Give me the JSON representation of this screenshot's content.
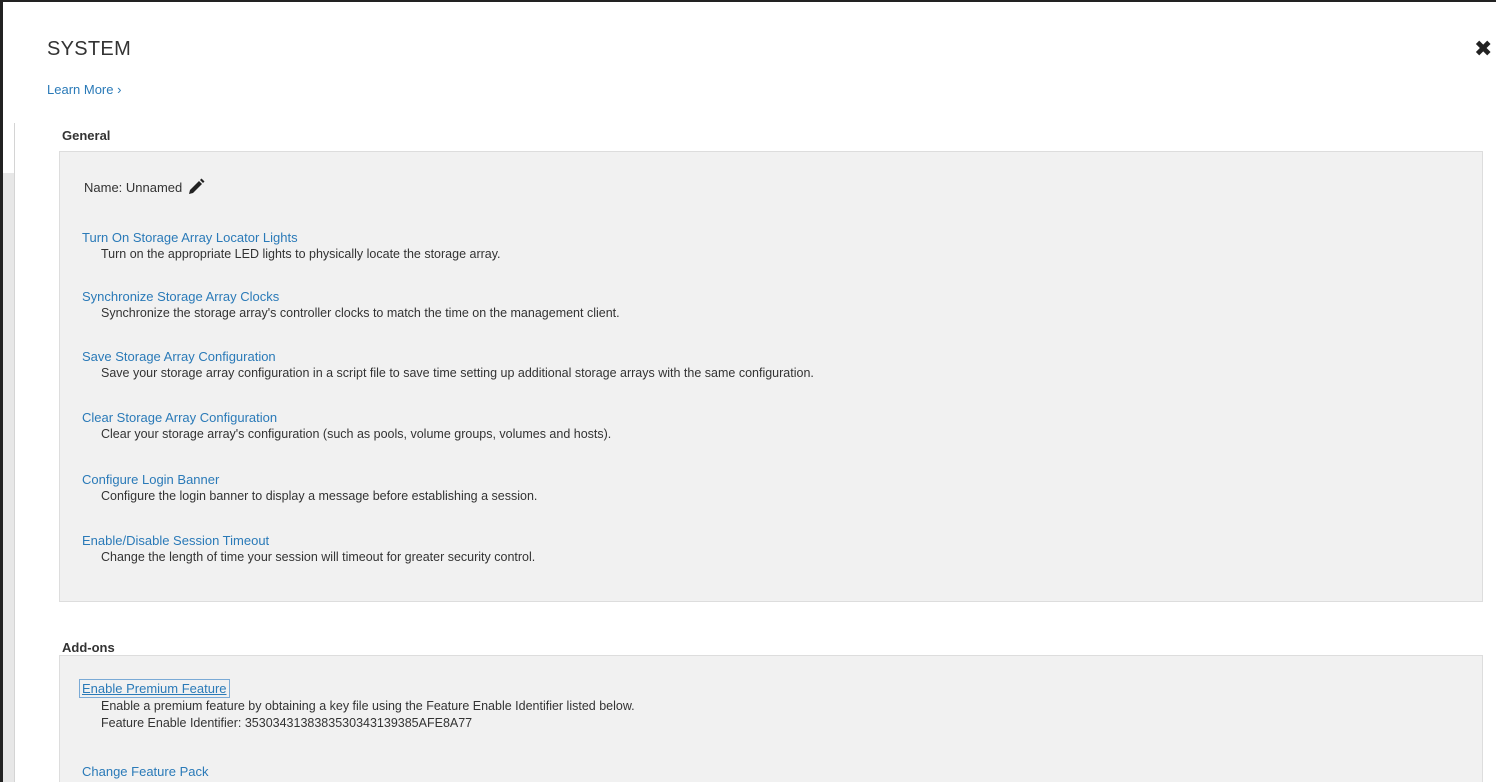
{
  "dialog": {
    "title": "SYSTEM",
    "close_label": "✖",
    "learn_more": "Learn More ›"
  },
  "general": {
    "heading": "General",
    "name_label": "Name: Unnamed",
    "items": [
      {
        "link": "Turn On Storage Array Locator Lights",
        "desc": "Turn on the appropriate LED lights to physically locate the storage array."
      },
      {
        "link": "Synchronize Storage Array Clocks",
        "desc": "Synchronize the storage array's controller clocks to match the time on the management client."
      },
      {
        "link": "Save Storage Array Configuration",
        "desc": "Save your storage array configuration in a script file to save time setting up additional storage arrays with the same configuration."
      },
      {
        "link": "Clear Storage Array Configuration",
        "desc": "Clear your storage array's configuration (such as pools, volume groups, volumes and hosts)."
      },
      {
        "link": "Configure Login Banner",
        "desc": "Configure the login banner to display a message before establishing a session."
      },
      {
        "link": "Enable/Disable Session Timeout",
        "desc": "Change the length of time your session will timeout for greater security control."
      }
    ]
  },
  "addons": {
    "heading": "Add-ons",
    "items": [
      {
        "link": "Enable Premium Feature",
        "desc": "Enable a premium feature by obtaining a key file using the Feature Enable Identifier listed below.",
        "extra": "Feature Enable Identifier: 3530343138383530343139385AFE8A77"
      },
      {
        "link": "Change Feature Pack"
      }
    ]
  },
  "icons": {
    "edit": "pencil-icon",
    "close": "close-icon",
    "learn_more_chevron": "chevron-right"
  },
  "colors": {
    "link": "#2a7ab8",
    "panel_bg": "#f1f1f1",
    "text": "#333333"
  }
}
